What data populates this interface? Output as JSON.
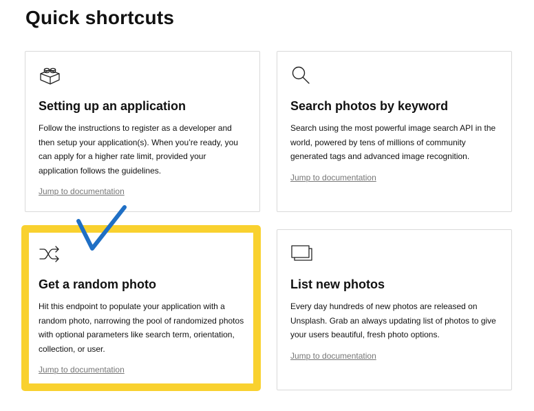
{
  "page": {
    "title": "Quick shortcuts"
  },
  "cards": [
    {
      "icon": "lego-brick-icon",
      "title": "Setting up an application",
      "desc_lines": [
        "Follow the instructions to register as a developer and",
        "then setup your application(s). When you’re ready, you",
        "can apply for a higher rate limit, provided your",
        "application follows the guidelines."
      ],
      "link": "Jump to documentation"
    },
    {
      "icon": "search-icon",
      "title": "Search photos by keyword",
      "desc_lines": [
        "Search using the most powerful image search API in the",
        "world, powered by tens of millions of community",
        "generated tags and advanced image recognition."
      ],
      "link": "Jump to documentation"
    },
    {
      "icon": "shuffle-icon",
      "title": "Get a random photo",
      "desc_lines": [
        "Hit this endpoint to populate your application with a",
        "random photo, narrowing the pool of randomized photos",
        "with optional parameters like search term, orientation,",
        "collection, or user."
      ],
      "link": "Jump to documentation"
    },
    {
      "icon": "stacked-windows-icon",
      "title": "List new photos",
      "desc_lines": [
        "Every day hundreds of new photos are released on",
        "Unsplash. Grab an always updating list of photos to give",
        "your users beautiful, fresh photo options."
      ],
      "link": "Jump to documentation"
    }
  ],
  "annotations": {
    "highlight_color": "#f9d12f",
    "checkmark_color": "#1f6fc5",
    "highlighted_card": "Get a random photo"
  }
}
